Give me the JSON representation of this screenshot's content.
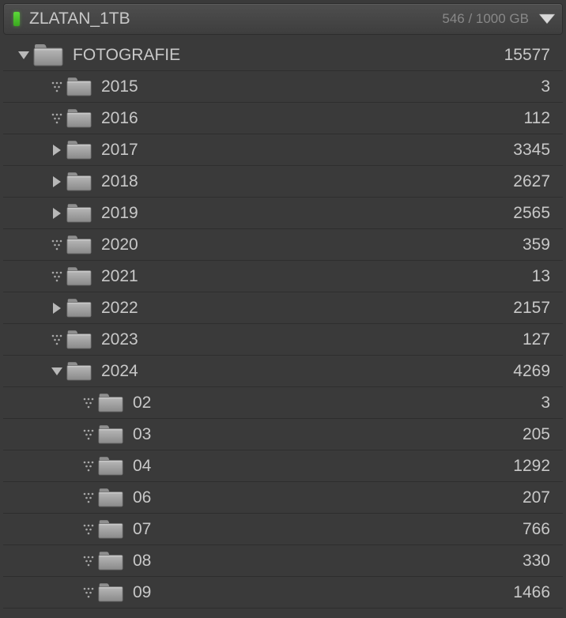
{
  "drive": {
    "name": "ZLATAN_1TB",
    "usage": "546 / 1000 GB"
  },
  "tree": [
    {
      "label": "FOTOGRAFIE",
      "count": "15577",
      "indent": 0,
      "toggle": "down",
      "iconSize": "large"
    },
    {
      "label": "2015",
      "count": "3",
      "indent": 1,
      "toggle": "dots",
      "iconSize": "small"
    },
    {
      "label": "2016",
      "count": "112",
      "indent": 1,
      "toggle": "dots",
      "iconSize": "small"
    },
    {
      "label": "2017",
      "count": "3345",
      "indent": 1,
      "toggle": "right",
      "iconSize": "small"
    },
    {
      "label": "2018",
      "count": "2627",
      "indent": 1,
      "toggle": "right",
      "iconSize": "small"
    },
    {
      "label": "2019",
      "count": "2565",
      "indent": 1,
      "toggle": "right",
      "iconSize": "small"
    },
    {
      "label": "2020",
      "count": "359",
      "indent": 1,
      "toggle": "dots",
      "iconSize": "small"
    },
    {
      "label": "2021",
      "count": "13",
      "indent": 1,
      "toggle": "dots",
      "iconSize": "small"
    },
    {
      "label": "2022",
      "count": "2157",
      "indent": 1,
      "toggle": "right",
      "iconSize": "small"
    },
    {
      "label": "2023",
      "count": "127",
      "indent": 1,
      "toggle": "dots",
      "iconSize": "small"
    },
    {
      "label": "2024",
      "count": "4269",
      "indent": 1,
      "toggle": "down",
      "iconSize": "small"
    },
    {
      "label": "02",
      "count": "3",
      "indent": 2,
      "toggle": "dots",
      "iconSize": "small"
    },
    {
      "label": "03",
      "count": "205",
      "indent": 2,
      "toggle": "dots",
      "iconSize": "small"
    },
    {
      "label": "04",
      "count": "1292",
      "indent": 2,
      "toggle": "dots",
      "iconSize": "small"
    },
    {
      "label": "06",
      "count": "207",
      "indent": 2,
      "toggle": "dots",
      "iconSize": "small"
    },
    {
      "label": "07",
      "count": "766",
      "indent": 2,
      "toggle": "dots",
      "iconSize": "small"
    },
    {
      "label": "08",
      "count": "330",
      "indent": 2,
      "toggle": "dots",
      "iconSize": "small"
    },
    {
      "label": "09",
      "count": "1466",
      "indent": 2,
      "toggle": "dots",
      "iconSize": "small"
    }
  ]
}
